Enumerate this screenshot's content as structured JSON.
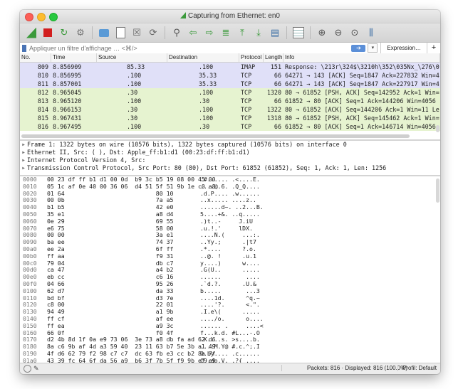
{
  "window": {
    "title": "Capturing from Ethernet: en0"
  },
  "toolbar": {
    "buttons": [
      {
        "name": "start-capture-icon"
      },
      {
        "name": "stop-capture-icon"
      },
      {
        "name": "restart-capture-icon"
      },
      {
        "name": "capture-options-icon"
      },
      {
        "name": "open-file-icon"
      },
      {
        "name": "save-file-icon"
      },
      {
        "name": "close-file-icon"
      },
      {
        "name": "reload-icon"
      },
      {
        "name": "find-icon"
      },
      {
        "name": "go-back-icon"
      },
      {
        "name": "go-forward-icon"
      },
      {
        "name": "go-to-packet-icon"
      },
      {
        "name": "go-first-icon"
      },
      {
        "name": "go-last-icon"
      },
      {
        "name": "autoscroll-icon"
      },
      {
        "name": "colorize-icon"
      },
      {
        "name": "zoom-in-icon"
      },
      {
        "name": "zoom-out-icon"
      },
      {
        "name": "zoom-normal-icon"
      },
      {
        "name": "resize-columns-icon"
      }
    ]
  },
  "filter": {
    "placeholder": "Appliquer un filtre d'affichage … <⌘/>",
    "expression_label": "Expression…",
    "plus_label": "+"
  },
  "packet_list": {
    "columns": [
      "No.",
      "Time",
      "Source",
      "Destination",
      "Protocol",
      "Length",
      "Info"
    ],
    "rows": [
      {
        "no": "809",
        "time": "8.856909",
        "src": "85.33",
        "dst": ".100",
        "proto": "IMAP",
        "len": "151",
        "info": "Response: \\213r\\324$\\3210h\\352\\035Nx_\\276\\0",
        "cls": "imap"
      },
      {
        "no": "810",
        "time": "8.856995",
        "src": ".100",
        "dst": "35.33",
        "proto": "TCP",
        "len": "66",
        "info": "64271 → 143 [ACK] Seq=1847 Ack=227832 Win=4",
        "cls": "imap"
      },
      {
        "no": "811",
        "time": "8.857001",
        "src": ".100",
        "dst": "35.33",
        "proto": "TCP",
        "len": "66",
        "info": "64271 → 143 [ACK] Seq=1847 Ack=227917 Win=4",
        "cls": "imap"
      },
      {
        "no": "812",
        "time": "8.965045",
        "src": ".30",
        "dst": ".100",
        "proto": "TCP",
        "len": "1320",
        "info": "80 → 61852 [PSH, ACK] Seq=142952 Ack=1 Win=",
        "cls": "tcp"
      },
      {
        "no": "813",
        "time": "8.965120",
        "src": ".100",
        "dst": ".30",
        "proto": "TCP",
        "len": "66",
        "info": "61852 → 80 [ACK] Seq=1 Ack=144206 Win=4056",
        "cls": "tcp"
      },
      {
        "no": "814",
        "time": "8.966153",
        "src": ".30",
        "dst": ".100",
        "proto": "TCP",
        "len": "1322",
        "info": "80 → 61852 [ACK] Seq=144206 Ack=1 Win=11 Le",
        "cls": "tcp"
      },
      {
        "no": "815",
        "time": "8.967431",
        "src": ".30",
        "dst": ".100",
        "proto": "TCP",
        "len": "1318",
        "info": "80 → 61852 [PSH, ACK] Seq=145462 Ack=1 Win=",
        "cls": "tcp"
      },
      {
        "no": "816",
        "time": "8.967495",
        "src": ".100",
        "dst": ".30",
        "proto": "TCP",
        "len": "66",
        "info": "61852 → 80 [ACK] Seq=1 Ack=146714 Win=4056",
        "cls": "tcp"
      }
    ]
  },
  "details": {
    "rows": [
      "Frame 1: 1322 bytes on wire (10576 bits), 1322 bytes captured (10576 bits) on interface 0",
      "Ethernet II, Src:                     (                    ), Dst: Apple_ff:b1:d1 (00:23:df:ff:b1:d1)",
      "Internet Protocol Version 4, Src:",
      "Transmission Control Protocol, Src Port: 80 (80), Dst Port: 61852 (61852), Seq: 1, Ack: 1, Len: 1256"
    ]
  },
  "bytes": {
    "rows": [
      {
        "off": "0000",
        "hex": "00 23 df ff b1 d1 00 0d  b9 3c b5 19 08 00 45 00",
        "asc": ".#...... .<....E."
      },
      {
        "off": "0010",
        "hex": "05 1c af 0e 40 00 36 06  d4 51 5f 51 9b 1e c0 a8",
        "asc": "....@.6. .Q_Q...."
      },
      {
        "off": "0020",
        "hex": "01 64                          80 10",
        "asc": ".d.P.... .w......"
      },
      {
        "off": "0030",
        "hex": "00 0b                          7a a5",
        "asc": "..x..... ....z.."
      },
      {
        "off": "0040",
        "hex": "b1 b5                          42 e0",
        "asc": "......d~. ..2...B."
      },
      {
        "off": "0050",
        "hex": "35 e1                          a8 d4",
        "asc": "5....+&. ..q....."
      },
      {
        "off": "0060",
        "hex": "0e 29                          69 55",
        "asc": ".)t..-     J.iU"
      },
      {
        "off": "0070",
        "hex": "e6 75                          58 00",
        "asc": ".u.!.'     lDX."
      },
      {
        "off": "0080",
        "hex": "00 00                          3a e1",
        "asc": "....N.(     ...:."
      },
      {
        "off": "0090",
        "hex": "ba ee                          74 37",
        "asc": "..Yy.;      .|t7"
      },
      {
        "off": "00a0",
        "hex": "ee 2a                          6f ff",
        "asc": ".*....      ?.o."
      },
      {
        "off": "00b0",
        "hex": "ff aa                          f9 31",
        "asc": "..@. !      .u.1"
      },
      {
        "off": "00c0",
        "hex": "79 04                          db c7",
        "asc": "y....)      w...."
      },
      {
        "off": "00d0",
        "hex": "ca 47                          a4 b2",
        "asc": ".G(U..      ....."
      },
      {
        "off": "00e0",
        "hex": "eb cc                          c6 16",
        "asc": "......       ...."
      },
      {
        "off": "00f0",
        "hex": "04 66                          95 26",
        "asc": ".`d.?.      .U.&"
      },
      {
        "off": "0100",
        "hex": "62 d7                          da 33",
        "asc": "b.....       ...3"
      },
      {
        "off": "0110",
        "hex": "bd bf                          d3 7e",
        "asc": "....1d.      ^q.~"
      },
      {
        "off": "0120",
        "hex": "c8 00                          22 01",
        "asc": "....'?.      <.\"."
      },
      {
        "off": "0130",
        "hex": "94 49                          a1 9b",
        "asc": ".I.e\\(      ....."
      },
      {
        "off": "0140",
        "hex": "ff cf                          af ee",
        "asc": "..../o.      o...."
      },
      {
        "off": "0150",
        "hex": "ff ea                          a9 3c",
        "asc": "...... .     ....<"
      },
      {
        "off": "0160",
        "hex": "66 0f                          f0 4f",
        "asc": "f...k.d. #L...-.O"
      },
      {
        "off": "0170",
        "hex": "d2 4b 8d 1f 0a e9 73 06  3e 73 a8 db fa ad 62 d6",
        "asc": ".K....s. >s....b."
      },
      {
        "off": "0180",
        "hex": "8a c6 9b af 4d a3 59 40  23 11 63 b7 5e 3b a1 49",
        "asc": "....M.Y@ #.c.^;.I"
      },
      {
        "off": "0190",
        "hex": "4f d6 62 79 f2 98 c7 c7  dc 63 fb e3 cc b2 8a 7f",
        "asc": "O.by.... .c......"
      },
      {
        "off": "01a0",
        "hex": "43 39 fc 64 6f da 56 a9  b6 3f 7b 5f f9 9b ef e9",
        "asc": "C9.do.V. .?{_...."
      }
    ]
  },
  "status": {
    "packets": "Packets: 816 · Displayed: 816 (100.0%)",
    "profile": "Profil: Default"
  }
}
